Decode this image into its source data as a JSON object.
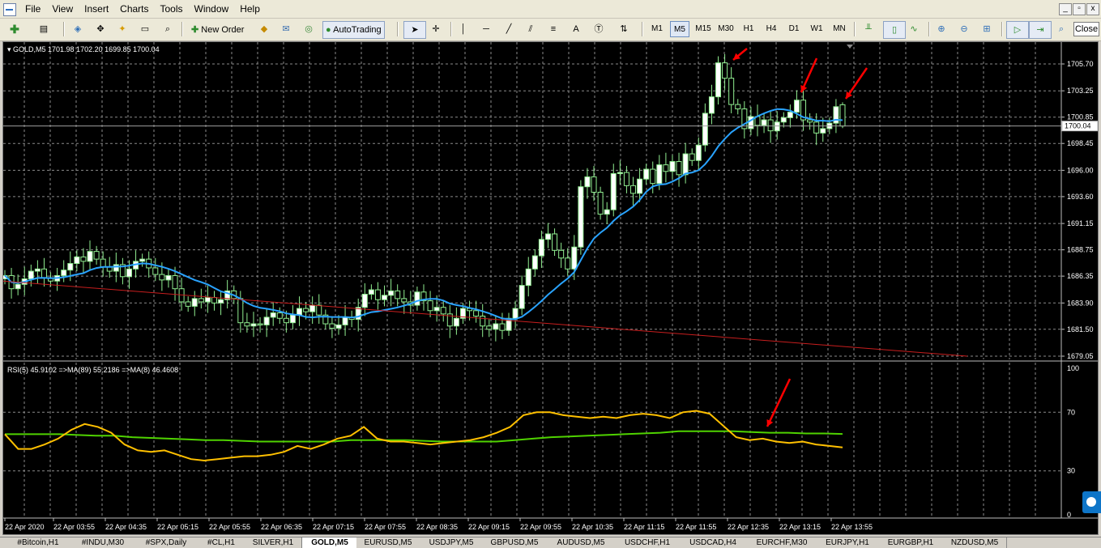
{
  "menu": [
    "File",
    "View",
    "Insert",
    "Charts",
    "Tools",
    "Window",
    "Help"
  ],
  "toolbar": {
    "new_order": "New Order",
    "autotrading": "AutoTrading",
    "timeframes": [
      "M1",
      "M5",
      "M15",
      "M30",
      "H1",
      "H4",
      "D1",
      "W1",
      "MN"
    ],
    "active_timeframe": "M5",
    "close": "Close",
    "icons": [
      "new-chart-icon",
      "profiles-icon",
      "market-watch-icon",
      "navigator-icon",
      "data-window-icon",
      "terminal-icon",
      "strategy-tester-icon",
      "new-order-icon",
      "metaeditor-icon",
      "mailbox-icon",
      "signal-icon",
      "autotrading-icon",
      "cursor-icon",
      "crosshair-icon",
      "vertical-line-icon",
      "horizontal-line-icon",
      "trendline-icon",
      "equidistant-channel-icon",
      "fibonacci-icon",
      "text-icon",
      "text-label-icon",
      "arrows-icon",
      "bar-chart-icon",
      "candlestick-icon",
      "line-chart-icon",
      "zoom-in-icon",
      "zoom-out-icon",
      "tile-windows-icon",
      "autoscroll-icon",
      "chart-shift-icon",
      "search-icon"
    ]
  },
  "window_controls": [
    "_",
    "▫",
    "x"
  ],
  "chart": {
    "header": "GOLD,M5  1701.98 1702.20 1699.85 1700.04",
    "current_price": "1700.04",
    "price_ticks": [
      "1705.70",
      "1703.25",
      "1700.85",
      "1698.45",
      "1696.00",
      "1693.60",
      "1691.15",
      "1688.75",
      "1686.35",
      "1683.90",
      "1681.50",
      "1679.05"
    ],
    "rsi_header": "RSI(5) 45.9102  =>MA(89) 55.2186  =>MA(8) 46.4608",
    "rsi_ticks": [
      "100",
      "70",
      "30",
      "0"
    ],
    "time_ticks": [
      "22 Apr 2020",
      "22 Apr 03:55",
      "22 Apr 04:35",
      "22 Apr 05:15",
      "22 Apr 05:55",
      "22 Apr 06:35",
      "22 Apr 07:15",
      "22 Apr 07:55",
      "22 Apr 08:35",
      "22 Apr 09:15",
      "22 Apr 09:55",
      "22 Apr 10:35",
      "22 Apr 11:15",
      "22 Apr 11:55",
      "22 Apr 12:35",
      "22 Apr 13:15",
      "22 Apr 13:55"
    ],
    "colors": {
      "background": "#000000",
      "grid": "#8a8a8a",
      "bull_candle": "#ffffff",
      "bear_candle": "#000000",
      "wick": "#90ee90",
      "ma_fast": "#29a3ff",
      "ma_slow": "#c81e1e",
      "rsi_line": "#ffc000",
      "rsi_ma": "#4fd200",
      "arrows": "#ff0000"
    }
  },
  "chart_data": {
    "type": "candlestick",
    "title": "GOLD,M5",
    "ohlc_last": {
      "open": 1701.98,
      "high": 1702.2,
      "low": 1699.85,
      "close": 1700.04
    },
    "close": [
      1686.4,
      1685.2,
      1685.6,
      1686.1,
      1686.8,
      1687.0,
      1686.2,
      1685.9,
      1686.4,
      1686.9,
      1687.5,
      1688.1,
      1687.7,
      1688.6,
      1687.9,
      1687.2,
      1686.8,
      1687.4,
      1686.3,
      1687.0,
      1687.7,
      1687.9,
      1687.1,
      1686.5,
      1686.0,
      1686.4,
      1685.2,
      1684.0,
      1683.6,
      1684.3,
      1684.0,
      1684.4,
      1683.9,
      1684.2,
      1685.0,
      1684.3,
      1682.1,
      1681.8,
      1682.0,
      1681.9,
      1682.6,
      1683.0,
      1682.5,
      1682.1,
      1682.8,
      1683.4,
      1683.1,
      1683.7,
      1682.8,
      1682.0,
      1681.6,
      1681.9,
      1682.6,
      1682.4,
      1683.5,
      1684.7,
      1685.1,
      1684.2,
      1684.6,
      1685.0,
      1684.3,
      1684.0,
      1683.7,
      1684.9,
      1684.1,
      1683.2,
      1683.5,
      1682.9,
      1681.8,
      1682.5,
      1683.4,
      1683.2,
      1682.7,
      1681.8,
      1681.5,
      1682.0,
      1681.4,
      1682.5,
      1683.4,
      1685.5,
      1687.0,
      1688.2,
      1689.7,
      1690.2,
      1688.7,
      1688.0,
      1687.0,
      1689.0,
      1694.5,
      1695.4,
      1694.0,
      1692.0,
      1692.4,
      1695.7,
      1695.8,
      1694.6,
      1693.9,
      1695.2,
      1696.1,
      1694.8,
      1696.5,
      1695.9,
      1696.8,
      1695.6,
      1697.5,
      1696.9,
      1698.3,
      1701.2,
      1702.7,
      1705.8,
      1704.4,
      1702.0,
      1701.6,
      1699.8,
      1700.9,
      1700.1,
      1700.6,
      1699.6,
      1700.4,
      1700.8,
      1701.3,
      1702.4,
      1700.6,
      1700.4,
      1699.4,
      1699.8,
      1700.3,
      1701.8,
      1700.04
    ],
    "series": [
      {
        "name": "RSI(5)",
        "last": 45.9102,
        "values": [
          55,
          45,
          45,
          48,
          52,
          58,
          62,
          60,
          56,
          48,
          44,
          43,
          44,
          41,
          38,
          37,
          38,
          39,
          40,
          40,
          41,
          43,
          47,
          45,
          48,
          52,
          54,
          60,
          52,
          50,
          50,
          49,
          48,
          49,
          50,
          51,
          53,
          56,
          60,
          68,
          70,
          70,
          68,
          67,
          66,
          67,
          66,
          68,
          69,
          68,
          66,
          70,
          71,
          69,
          61,
          53,
          51,
          52,
          50,
          49,
          50,
          48,
          47,
          46
        ]
      },
      {
        "name": "MA(89)",
        "last": 55.2186,
        "values": [
          55,
          55,
          55,
          55,
          54.5,
          54,
          54,
          53,
          52.5,
          52,
          51.5,
          51,
          51,
          50.5,
          50,
          50,
          50,
          50,
          50,
          51,
          51,
          51,
          51,
          50.5,
          50,
          50,
          50,
          50,
          51,
          52,
          53,
          53.5,
          54,
          54.5,
          55,
          55.5,
          56,
          57,
          57,
          57,
          57,
          56.5,
          56,
          56,
          55.5,
          55.5,
          55.2
        ]
      },
      {
        "name": "MA(8)",
        "last": 46.4608
      }
    ],
    "ylim": [
      1679.05,
      1705.7
    ],
    "rsi_ylim": [
      0,
      100
    ]
  },
  "tabs": [
    "#Bitcoin,H1",
    "#INDU,M30",
    "#SPX,Daily",
    "#CL,H1",
    "SILVER,H1",
    "GOLD,M5",
    "EURUSD,M5",
    "USDJPY,M5",
    "GBPUSD,M5",
    "AUDUSD,M5",
    "USDCHF,H1",
    "USDCAD,H4",
    "EURCHF,M30",
    "EURJPY,H1",
    "EURGBP,H1",
    "NZDUSD,M5"
  ],
  "active_tab": "GOLD,M5"
}
